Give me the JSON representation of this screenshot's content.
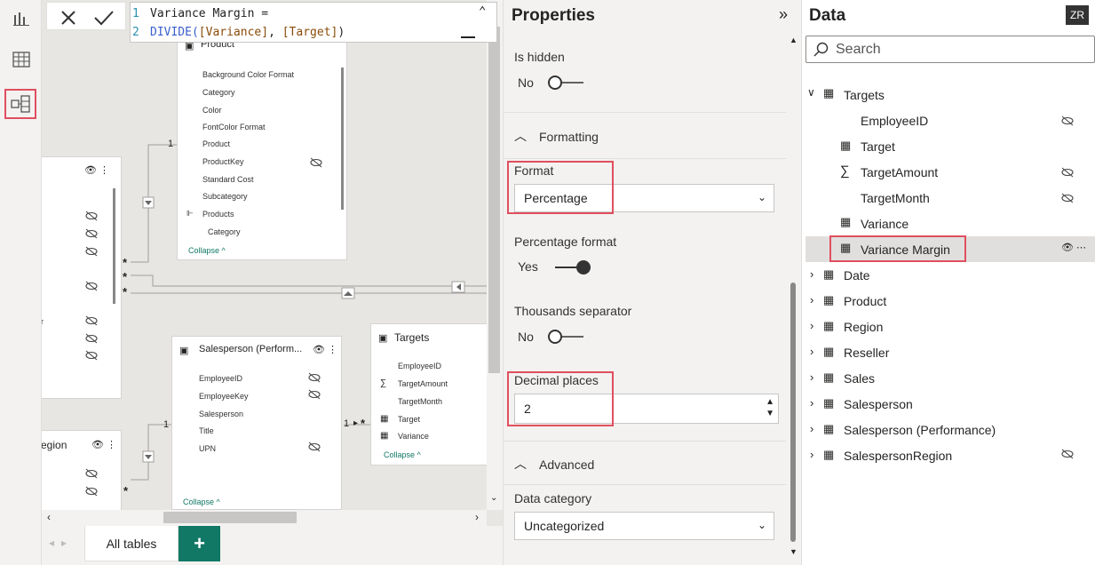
{
  "formula": {
    "line1_num": "1",
    "line1": "Variance Margin =",
    "line2_num": "2",
    "line2_fn": "DIVIDE(",
    "line2_a": "[Variance]",
    ",": ", ",
    "line2_b": "[Target]",
    "line2_end": ")"
  },
  "canvas": {
    "product": {
      "title": "Product",
      "fields": [
        "Background Color Format",
        "Category",
        "Color",
        "FontColor Format",
        "Product",
        "ProductKey",
        "Standard Cost",
        "Subcategory",
        "Products",
        "Category"
      ],
      "collapse": "Collapse"
    },
    "salesperson_perf": {
      "title": "Salesperson (Perform...",
      "fields": [
        "EmployeeID",
        "EmployeeKey",
        "Salesperson",
        "Title",
        "UPN"
      ],
      "collapse": "Collapse"
    },
    "targets": {
      "title": "Targets",
      "fields": [
        "EmployeeID",
        "TargetAmount",
        "TargetMonth",
        "Target",
        "Variance"
      ],
      "collapse": "Collapse"
    },
    "left_card_partial": "er",
    "region_partial": "egion",
    "rel": {
      "one": "1",
      "many": "*",
      "one2": "1",
      "one3": "1"
    },
    "tabs": {
      "all": "All tables",
      "add": "+"
    }
  },
  "properties": {
    "title": "Properties",
    "is_hidden": "Is hidden",
    "is_hidden_val": "No",
    "formatting": "Formatting",
    "format": "Format",
    "format_val": "Percentage",
    "pct_format": "Percentage format",
    "pct_val": "Yes",
    "thousands": "Thousands separator",
    "thousands_val": "No",
    "decimal": "Decimal places",
    "decimal_val": "2",
    "advanced": "Advanced",
    "data_category": "Data category",
    "data_category_val": "Uncategorized"
  },
  "data": {
    "title": "Data",
    "avatar": "ZR",
    "search_placeholder": "Search",
    "targets_table": "Targets",
    "target_fields": [
      "EmployeeID",
      "Target",
      "TargetAmount",
      "TargetMonth",
      "Variance",
      "Variance Margin"
    ],
    "tables": [
      "Date",
      "Product",
      "Region",
      "Reseller",
      "Sales",
      "Salesperson",
      "Salesperson (Performance)",
      "SalespersonRegion"
    ]
  },
  "colors": {
    "accent": "#117865",
    "highlight": "#e04f5f"
  }
}
